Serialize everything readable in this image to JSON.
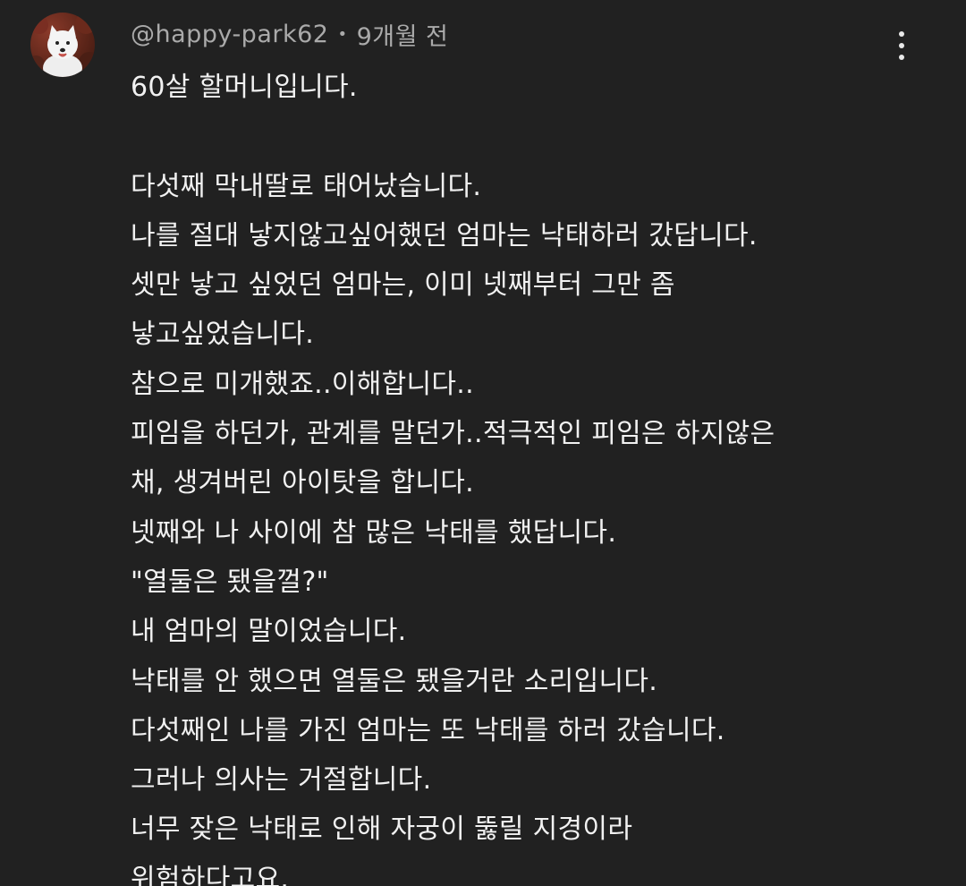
{
  "comment": {
    "username": "@happy-park62",
    "separator": "•",
    "timestamp": "9개월 전",
    "lines": [
      "60살 할머니입니다.",
      "",
      "다섯째 막내딸로 태어났습니다.",
      "나를 절대 낳지않고싶어했던 엄마는 낙태하러 갔답니다.",
      "셋만 낳고 싶었던 엄마는, 이미 넷째부터 그만 좀",
      "낳고싶었습니다.",
      "참으로 미개했죠..이해합니다..",
      "피임을 하던가, 관계를 말던가..적극적인 피임은 하지않은",
      "채, 생겨버린 아이탓을 합니다.",
      "넷째와 나 사이에 참 많은 낙태를 했답니다.",
      "\"열둘은 됐을껄?\"",
      "내 엄마의 말이었습니다.",
      "낙태를 안 했으면 열둘은 됐을거란 소리입니다.",
      "다섯째인 나를 가진 엄마는 또 낙태를 하러 갔습니다.",
      "그러나 의사는 거절합니다.",
      "너무 잦은 낙태로 인해 자궁이 뚫릴 지경이라",
      "위험하다고요."
    ]
  },
  "icons": {
    "avatar": "white-dog-avatar",
    "menu": "more-vert-icon"
  },
  "colors": {
    "background": "#212121",
    "text": "#f1f1f1",
    "meta": "#aaaaaa"
  }
}
